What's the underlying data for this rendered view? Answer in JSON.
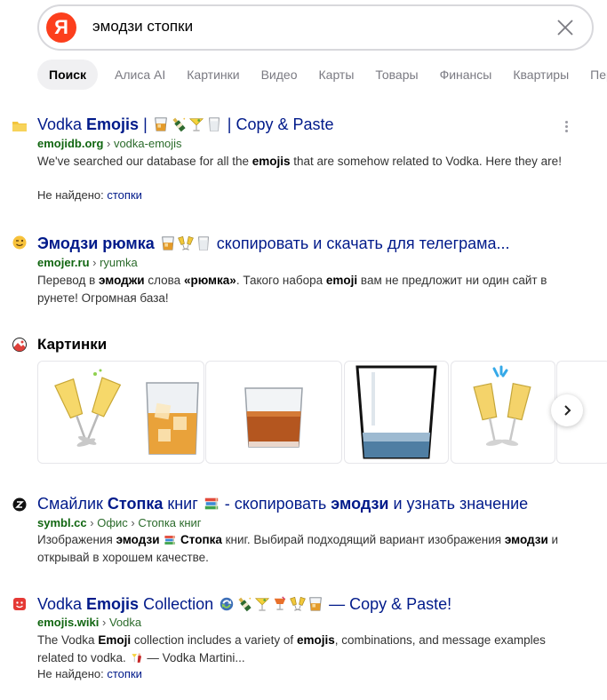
{
  "search": {
    "logo": "Я",
    "query": "эмодзи стопки"
  },
  "tabs": [
    "Поиск",
    "Алиса AI",
    "Картинки",
    "Видео",
    "Карты",
    "Товары",
    "Финансы",
    "Квартиры",
    "Пере"
  ],
  "results": [
    {
      "title_pre": "Vodka ",
      "title_bold": "Emojis",
      "title_mid": " | ",
      "title_post": " | Copy & Paste",
      "title_emojis": [
        "tumbler-glass",
        "champagne-bottle",
        "cocktail-glass",
        "milk-glass"
      ],
      "domain": "emojidb.org",
      "path": "vodka-emojis",
      "snippet_1": "We've searched our database for all the ",
      "snippet_b1": "emojis",
      "snippet_2": " that are somehow related to Vodka. Here they are!",
      "missing_label": "Не найдено:",
      "missing_word": "стопки",
      "favicon": "folder-icon"
    },
    {
      "title_bold": "Эмодзи рюмка",
      "title_post": " скопировать и скачать для телеграма...",
      "title_emojis": [
        "tumbler-glass",
        "clinking-glasses",
        "milk-glass"
      ],
      "domain": "emojer.ru",
      "path": "ryumka",
      "snippet_1": "Перевод в ",
      "snippet_b1": "эмоджи",
      "snippet_2": " слова ",
      "snippet_b2": "«рюмка»",
      "snippet_3": ". Такого набора ",
      "snippet_b3": "emoji",
      "snippet_4": " вам не предложит ни один сайт в рунете! Огромная база!",
      "favicon": "wink-face-icon"
    },
    {
      "title_pre": "Смайлик ",
      "title_bold": "Стопка",
      "title_mid": " книг ",
      "title_post_1": " - скопировать ",
      "title_bold_2": "эмодзи",
      "title_post_2": " и узнать значение",
      "title_emojis": [
        "books"
      ],
      "domain": "symbl.cc",
      "path_1": "Офис",
      "path_2": "Стопка книг",
      "snippet_1": "Изображения ",
      "snippet_b1": "эмодзи",
      "snippet_b2": "Стопка",
      "snippet_2": " книг. Выбирай подходящий вариант изображения ",
      "snippet_b3": "эмодзи",
      "snippet_3": " и открывай в хорошем качестве.",
      "favicon": "symbl-logo-icon"
    },
    {
      "title_pre": "Vodka ",
      "title_bold": "Emojis",
      "title_mid": " Collection ",
      "title_post": " — Copy & Paste!",
      "title_emojis": [
        "arrows",
        "champagne-bottle",
        "cocktail-glass",
        "tropical-drink",
        "clinking-glasses",
        "tumbler-glass"
      ],
      "domain": "emojis.wiki",
      "path": "Vodka",
      "snippet_1": "The Vodka ",
      "snippet_b1": "Emoji",
      "snippet_2": " collection includes a variety of ",
      "snippet_b2": "emojis",
      "snippet_3": ", combinations, and message examples related to vodka. ",
      "snippet_4": " — Vodka Martini...",
      "missing_label": "Не найдено:",
      "missing_word": "стопки",
      "favicon": "emojis-wiki-icon"
    }
  ],
  "images": {
    "heading": "Картинки",
    "items": [
      "clinking-glasses",
      "whiskey-glass-ice",
      "whiskey-glass",
      "empty-tumbler",
      "champagne-toast"
    ]
  },
  "colors": {
    "brand": "#fc3f1d",
    "link": "#001a8a",
    "domain": "#116611"
  }
}
